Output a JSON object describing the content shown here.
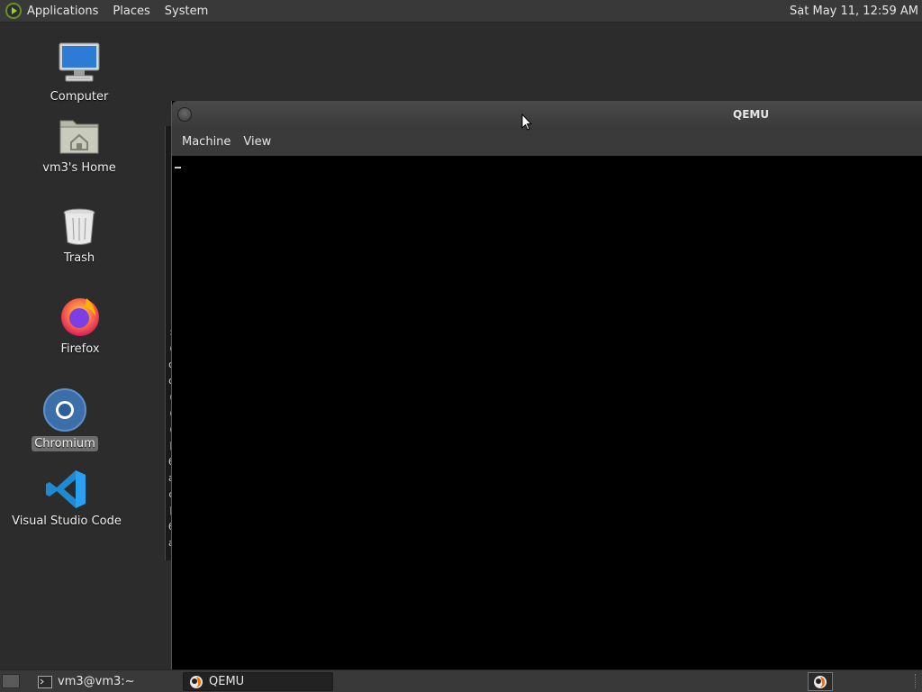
{
  "top_panel": {
    "menus": [
      "Applications",
      "Places",
      "System"
    ],
    "clock": "Sat May 11, 12:59 AM"
  },
  "desktop": {
    "icons": [
      {
        "label": "Computer",
        "icon": "computer-icon"
      },
      {
        "label": "vm3's Home",
        "icon": "home-folder-icon"
      },
      {
        "label": "Trash",
        "icon": "trash-icon"
      },
      {
        "label": "Firefox",
        "icon": "firefox-icon"
      },
      {
        "label": "Chromium",
        "icon": "chromium-icon",
        "selected": true
      },
      {
        "label": "Visual Studio Code",
        "icon": "vscode-icon"
      }
    ]
  },
  "back_window": {
    "fragments": [
      ":",
      "(",
      "o",
      "o",
      "(",
      "(",
      "(",
      "[",
      "6",
      "a",
      "c",
      "[",
      "6",
      "a"
    ]
  },
  "qemu_window": {
    "title": "QEMU",
    "menus": [
      "Machine",
      "View"
    ]
  },
  "bottom_panel": {
    "tasks": [
      {
        "label": "vm3@vm3:~",
        "icon": "terminal-icon"
      },
      {
        "label": "QEMU",
        "icon": "qemu-icon",
        "active": true
      }
    ]
  },
  "colors": {
    "panel": "#393939",
    "desktop": "#2c2c2c",
    "qemu_screen": "#000000"
  }
}
